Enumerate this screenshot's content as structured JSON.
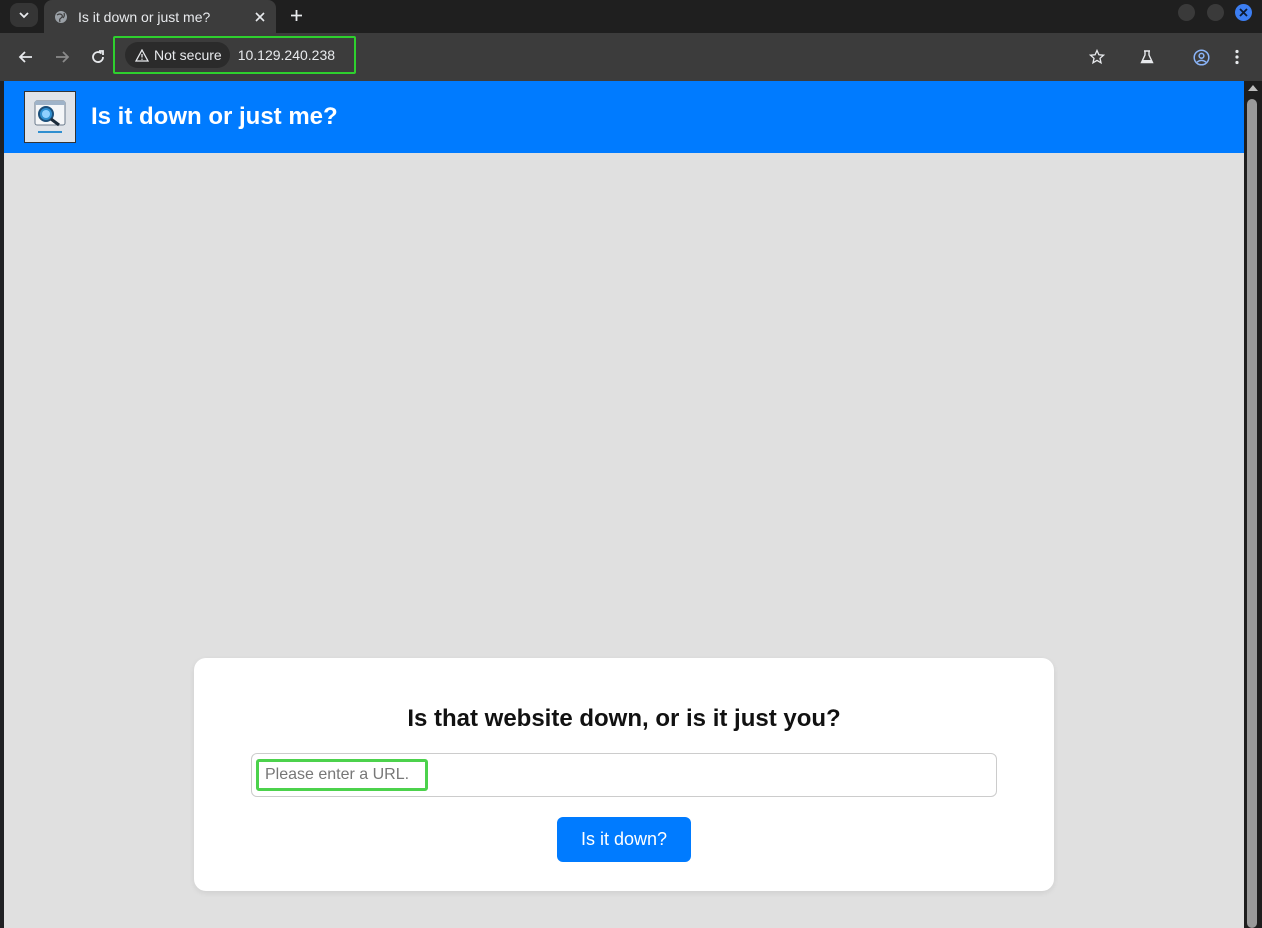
{
  "browser": {
    "tab": {
      "title": "Is it down or just me?"
    },
    "address_bar": {
      "security_label": "Not secure",
      "url": "10.129.240.238"
    }
  },
  "page": {
    "header": {
      "title": "Is it down or just me?"
    },
    "form": {
      "heading": "Is that website down, or is it just you?",
      "url_placeholder": "Please enter a URL.",
      "url_value": "",
      "submit_label": "Is it down?"
    }
  },
  "colors": {
    "brand_blue": "#007bff",
    "highlight_green": "#2ed02e",
    "page_background": "#e0e0e0"
  },
  "icons": {
    "tab_search": "chevron-down-icon",
    "tab_favicon": "globe-icon",
    "tab_close": "close-icon",
    "new_tab": "plus-icon",
    "back": "arrow-left-icon",
    "forward": "arrow-right-icon",
    "reload": "reload-icon",
    "security": "warning-triangle-icon",
    "bookmark": "star-icon",
    "labs": "flask-icon",
    "profile": "profile-icon",
    "menu": "kebab-menu-icon",
    "logo": "magnifier-logo"
  }
}
